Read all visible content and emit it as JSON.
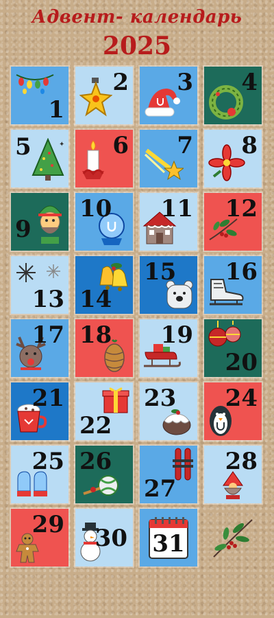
{
  "header": {
    "title": "Адвент- календарь",
    "year": "2025"
  },
  "colors": {
    "title": "#b71c1c",
    "light_blue": "#b9dcf4",
    "mid_blue": "#5aa9e6",
    "dark_blue": "#1e78c8",
    "red": "#ef5350",
    "teal": "#1d6b5a"
  },
  "days": [
    {
      "n": "1",
      "icon": "lights-garland-icon"
    },
    {
      "n": "2",
      "icon": "star-ornament-icon"
    },
    {
      "n": "3",
      "icon": "santa-hat-icon"
    },
    {
      "n": "4",
      "icon": "wreath-icon"
    },
    {
      "n": "5",
      "icon": "christmas-tree-icon"
    },
    {
      "n": "6",
      "icon": "candle-icon"
    },
    {
      "n": "7",
      "icon": "shooting-star-icon"
    },
    {
      "n": "8",
      "icon": "poinsettia-icon"
    },
    {
      "n": "9",
      "icon": "elf-icon"
    },
    {
      "n": "10",
      "icon": "snow-globe-icon"
    },
    {
      "n": "11",
      "icon": "gingerbread-house-icon"
    },
    {
      "n": "12",
      "icon": "mistletoe-icon"
    },
    {
      "n": "13",
      "icon": "snowflakes-icon"
    },
    {
      "n": "14",
      "icon": "bells-icon"
    },
    {
      "n": "15",
      "icon": "polar-bear-icon"
    },
    {
      "n": "16",
      "icon": "ice-skate-icon"
    },
    {
      "n": "17",
      "icon": "reindeer-icon"
    },
    {
      "n": "18",
      "icon": "pinecone-icon"
    },
    {
      "n": "19",
      "icon": "sleigh-icon"
    },
    {
      "n": "20",
      "icon": "baubles-icon"
    },
    {
      "n": "21",
      "icon": "hot-cocoa-icon"
    },
    {
      "n": "22",
      "icon": "gift-box-icon"
    },
    {
      "n": "23",
      "icon": "christmas-pudding-icon"
    },
    {
      "n": "24",
      "icon": "penguin-icon"
    },
    {
      "n": "25",
      "icon": "mittens-icon"
    },
    {
      "n": "26",
      "icon": "candy-icon"
    },
    {
      "n": "27",
      "icon": "skis-icon"
    },
    {
      "n": "28",
      "icon": "gnome-icon"
    },
    {
      "n": "29",
      "icon": "gingerbread-man-icon"
    },
    {
      "n": "30",
      "icon": "snowman-icon"
    },
    {
      "n": "31",
      "icon": "calendar-icon"
    }
  ]
}
